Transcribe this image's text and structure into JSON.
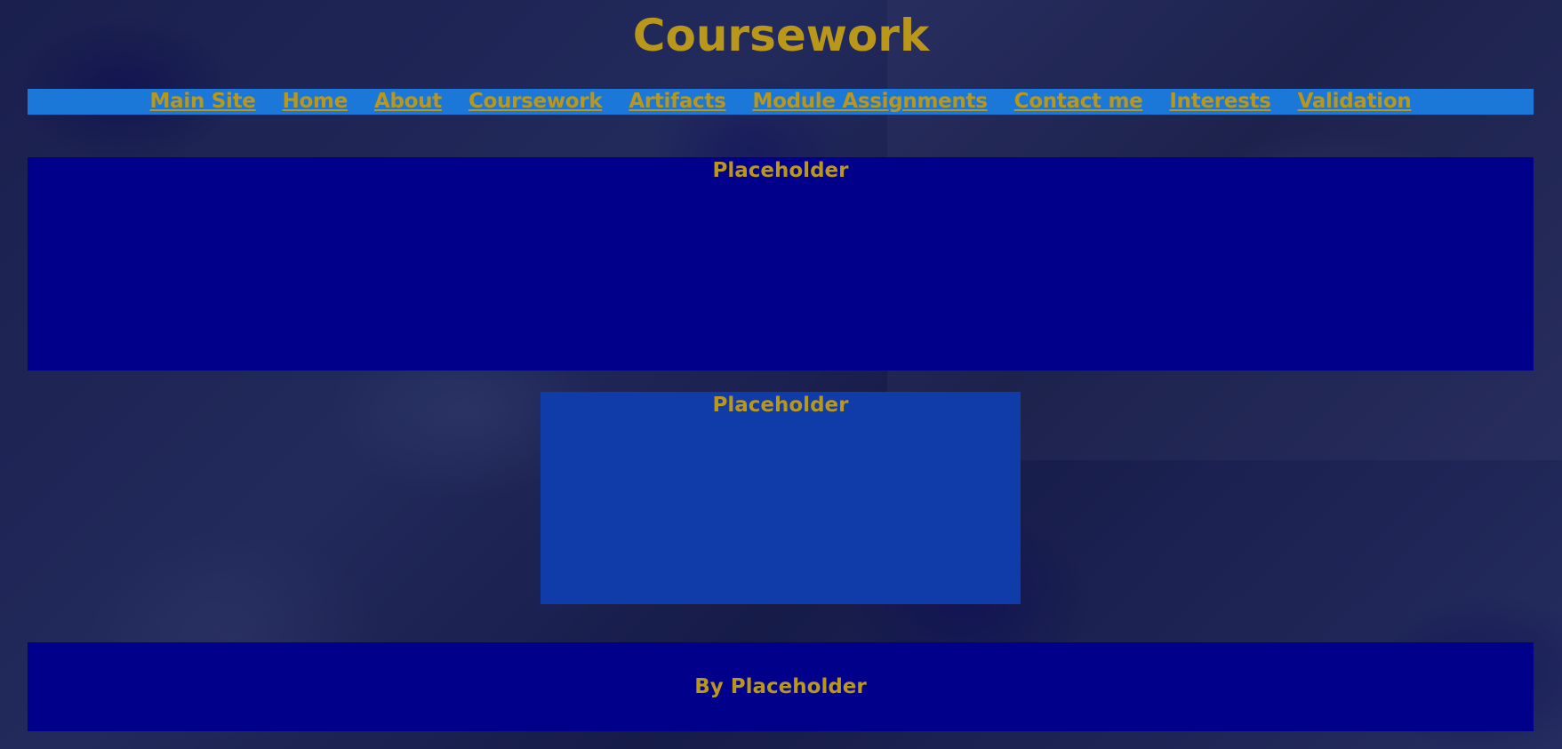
{
  "page": {
    "title": "Coursework"
  },
  "nav": {
    "items": [
      {
        "label": "Main Site"
      },
      {
        "label": "Home"
      },
      {
        "label": "About"
      },
      {
        "label": "Coursework"
      },
      {
        "label": "Artifacts"
      },
      {
        "label": "Module Assignments"
      },
      {
        "label": "Contact me"
      },
      {
        "label": "Interests"
      },
      {
        "label": "Validation"
      }
    ]
  },
  "sections": {
    "main_heading": "Placeholder",
    "secondary_heading": "Placeholder"
  },
  "footer": {
    "text": "By Placeholder"
  },
  "colors": {
    "text_gold": "#b8971a",
    "nav_bg": "#1c78d8",
    "panel_dark_blue": "#00008b",
    "panel_mid_blue": "#0f3ca8",
    "background": "#1b2250"
  }
}
